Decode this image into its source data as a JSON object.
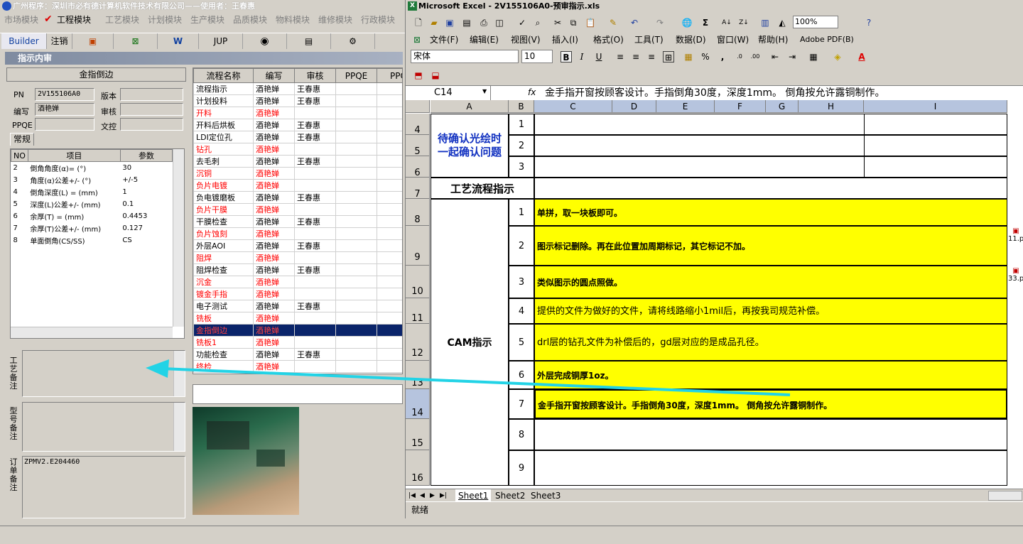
{
  "left_app": {
    "title": "广州程序：深圳市必有德计算机软件技术有限公司——使用者：王春惠",
    "menu": [
      "市场模块",
      "工程模块",
      "工艺模块",
      "计划模块",
      "生产模块",
      "品质模块",
      "物料模块",
      "维修模块",
      "行政模块"
    ],
    "active_menu": "工程模块",
    "toolbar": [
      "Builder",
      "注销",
      "JUP"
    ],
    "subwindow_title": "指示内审",
    "panel_title": "金指倒边",
    "fields": {
      "pn_label": "PN",
      "pn_value": "2V155106A0",
      "version_label": "版本",
      "version_value": "",
      "author_label": "编写",
      "author_value": "酒艳婵",
      "review_label": "审核",
      "review_value": "",
      "ppqe_label": "PPQE",
      "ppqe_value": "",
      "control_label": "文控",
      "control_value": ""
    },
    "tab_label": "常规",
    "param_headers": [
      "NO",
      "项目",
      "参数"
    ],
    "params": [
      {
        "no": "2",
        "item": "倒角角度(α)=  (°)",
        "value": "30"
      },
      {
        "no": "3",
        "item": "角度(α)公差+/-  (°)",
        "value": "+/-5"
      },
      {
        "no": "4",
        "item": "倒角深度(L) =  (mm)",
        "value": "1"
      },
      {
        "no": "5",
        "item": "深度(L)公差+/-  (mm)",
        "value": "0.1"
      },
      {
        "no": "6",
        "item": "余厚(T) =  (mm)",
        "value": "0.4453"
      },
      {
        "no": "7",
        "item": "余厚(T)公差+/-  (mm)",
        "value": "0.127"
      },
      {
        "no": "8",
        "item": "单面倒角(CS/SS)",
        "value": "CS"
      }
    ],
    "memo_labels": [
      "工艺备注",
      "型号备注",
      "订单备注"
    ],
    "order_note": "ZPMV2.E204460",
    "flow_headers": [
      "流程名称",
      "编写",
      "审核",
      "PPQE",
      "PPQ"
    ],
    "flow_rows": [
      {
        "name": "流程指示",
        "author": "酒艳婵",
        "review": "王春惠",
        "red": false
      },
      {
        "name": "计划投料",
        "author": "酒艳婵",
        "review": "王春惠",
        "red": false
      },
      {
        "name": "开料",
        "author": "酒艳婵",
        "review": "",
        "red": true
      },
      {
        "name": "开料后烘板",
        "author": "酒艳婵",
        "review": "王春惠",
        "red": false
      },
      {
        "name": "LDI定位孔",
        "author": "酒艳婵",
        "review": "王春惠",
        "red": false
      },
      {
        "name": "钻孔",
        "author": "酒艳婵",
        "review": "",
        "red": true
      },
      {
        "name": "去毛刺",
        "author": "酒艳婵",
        "review": "王春惠",
        "red": false
      },
      {
        "name": "沉铜",
        "author": "酒艳婵",
        "review": "",
        "red": true
      },
      {
        "name": "负片电镀",
        "author": "酒艳婵",
        "review": "",
        "red": true
      },
      {
        "name": "负电镀磨板",
        "author": "酒艳婵",
        "review": "王春惠",
        "red": false
      },
      {
        "name": "负片干膜",
        "author": "酒艳婵",
        "review": "",
        "red": true
      },
      {
        "name": "干膜检查",
        "author": "酒艳婵",
        "review": "王春惠",
        "red": false
      },
      {
        "name": "负片蚀刻",
        "author": "酒艳婵",
        "review": "",
        "red": true
      },
      {
        "name": "外层AOI",
        "author": "酒艳婵",
        "review": "王春惠",
        "red": false
      },
      {
        "name": "阻焊",
        "author": "酒艳婵",
        "review": "",
        "red": true
      },
      {
        "name": "阻焊检查",
        "author": "酒艳婵",
        "review": "王春惠",
        "red": false
      },
      {
        "name": "沉金",
        "author": "酒艳婵",
        "review": "",
        "red": true
      },
      {
        "name": "镀金手指",
        "author": "酒艳婵",
        "review": "",
        "red": true
      },
      {
        "name": "电子测试",
        "author": "酒艳婵",
        "review": "王春惠",
        "red": false
      },
      {
        "name": "铣板",
        "author": "酒艳婵",
        "review": "",
        "red": true
      },
      {
        "name": "金指倒边",
        "author": "酒艳婵",
        "review": "",
        "red": true,
        "selected": true
      },
      {
        "name": "铣板1",
        "author": "酒艳婵",
        "review": "",
        "red": true
      },
      {
        "name": "功能检查",
        "author": "酒艳婵",
        "review": "王春惠",
        "red": false
      },
      {
        "name": "终检",
        "author": "酒艳婵",
        "review": "",
        "red": true
      }
    ]
  },
  "excel": {
    "title": "Microsoft Excel - 2V155106A0-预审指示.xls",
    "zoom": "100%",
    "menu": [
      "文件(F)",
      "编辑(E)",
      "视图(V)",
      "插入(I)",
      "格式(O)",
      "工具(T)",
      "数据(D)",
      "窗口(W)",
      "帮助(H)",
      "Adobe PDF(B)"
    ],
    "font_name": "宋体",
    "font_size": "10",
    "format_buttons": [
      "B",
      "I",
      "U"
    ],
    "name_box": "C14",
    "formula": "金手指开窗按顾客设计。手指倒角30度，深度1mm。 倒角按允许露铜制作。",
    "columns": [
      "A",
      "B",
      "C",
      "D",
      "E",
      "F",
      "G",
      "H",
      "I"
    ],
    "pending_label": "待确认光绘时一起确认问题",
    "process_label": "工艺流程指示",
    "cam_label": "CAM指示",
    "rows": [
      {
        "row": "4",
        "b": "1",
        "c": ""
      },
      {
        "row": "5",
        "b": "2",
        "c": ""
      },
      {
        "row": "6",
        "b": "3",
        "c": ""
      },
      {
        "row": "7",
        "b": "",
        "c": ""
      },
      {
        "row": "8",
        "b": "1",
        "c": "单拼，取一块板即可。"
      },
      {
        "row": "9",
        "b": "2",
        "c": "图示标记删除。再在此位置加周期标记，其它标记不加。"
      },
      {
        "row": "10",
        "b": "3",
        "c": "类似图示的圆点照做。"
      },
      {
        "row": "11",
        "b": "4",
        "c": "提供的文件为做好的文件，请将线路缩小1mil后，再按我司规范补偿。"
      },
      {
        "row": "12",
        "b": "5",
        "c": "drl层的钻孔文件为补偿后的，gd层对应的是成品孔径。"
      },
      {
        "row": "13",
        "b": "6",
        "c": "外层完成铜厚1oz。"
      },
      {
        "row": "14",
        "b": "7",
        "c": "金手指开窗按顾客设计。手指倒角30度，深度1mm。 倒角按允许露铜制作。"
      },
      {
        "row": "15",
        "b": "8",
        "c": ""
      },
      {
        "row": "16",
        "b": "9",
        "c": ""
      }
    ],
    "embedded": [
      "11.p",
      "33.p"
    ],
    "sheets": [
      "Sheet1",
      "Sheet2",
      "Sheet3"
    ],
    "status": "就绪"
  },
  "colors": {
    "yellow": "#ffff00",
    "red": "#ff0000",
    "arrow": "#22d3e6",
    "selection": "#0a246a"
  }
}
